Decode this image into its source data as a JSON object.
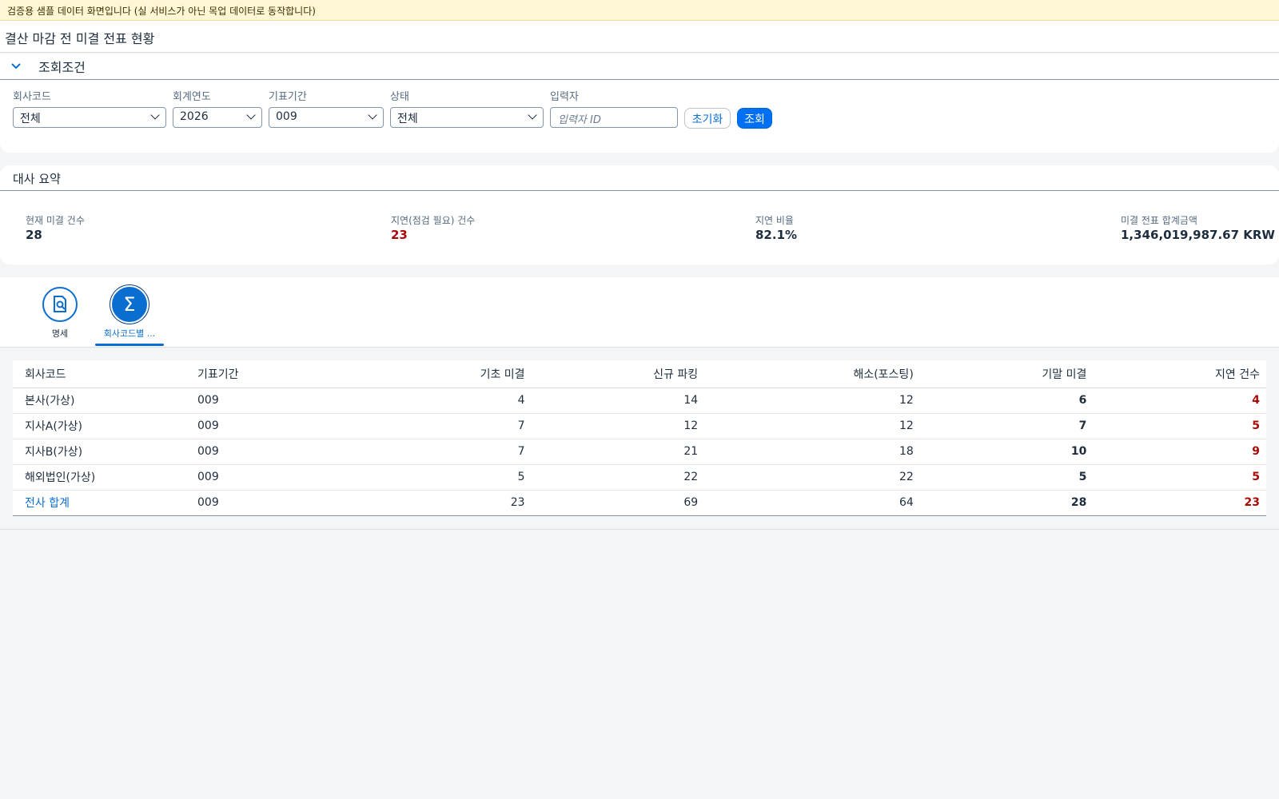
{
  "banner": "검증용 샘플 데이터 화면입니다 (실 서비스가 아닌 목업 데이터로 동작합니다)",
  "title": "결산 마감 전 미결 전표 현황",
  "filter": {
    "section_title": "조회조건",
    "company_label": "회사코드",
    "company_value": "전체",
    "year_label": "회계연도",
    "year_value": "2026",
    "period_label": "기표기간",
    "period_value": "009",
    "status_label": "상태",
    "status_value": "전체",
    "user_label": "입력자",
    "user_placeholder": "입력자 ID",
    "reset_label": "초기화",
    "search_label": "조회"
  },
  "summary": {
    "section_title": "대사 요약",
    "open_count_label": "현재 미결 건수",
    "open_count_value": "28",
    "delayed_label": "지연(점검 필요) 건수",
    "delayed_value": "23",
    "delay_rate_label": "지연 비율",
    "delay_rate_value": "82.1%",
    "amount_label": "미결 전표 합계금액",
    "amount_value": "1,346,019,987.67 KRW"
  },
  "tabs": [
    {
      "label": "명세",
      "icon": "document-search-icon",
      "active": false
    },
    {
      "label": "회사코드별 ...",
      "icon": "sigma-icon",
      "active": true
    }
  ],
  "table": {
    "headers": [
      "회사코드",
      "기표기간",
      "기초 미결",
      "신규 파킹",
      "해소(포스팅)",
      "기말 미결",
      "지연 건수"
    ],
    "rows": [
      [
        "본사(가상)",
        "009",
        "4",
        "14",
        "12",
        "6",
        "4"
      ],
      [
        "지사A(가상)",
        "009",
        "7",
        "12",
        "12",
        "7",
        "5"
      ],
      [
        "지사B(가상)",
        "009",
        "7",
        "21",
        "18",
        "10",
        "9"
      ],
      [
        "해외법인(가상)",
        "009",
        "5",
        "22",
        "22",
        "5",
        "5"
      ],
      [
        "전사 합계",
        "009",
        "23",
        "69",
        "64",
        "28",
        "23"
      ]
    ]
  },
  "colors": {
    "accent": "#0a6ed1",
    "primary_button": "#0070f2",
    "alert": "#aa0808",
    "banner_bg": "#fff6d6"
  }
}
